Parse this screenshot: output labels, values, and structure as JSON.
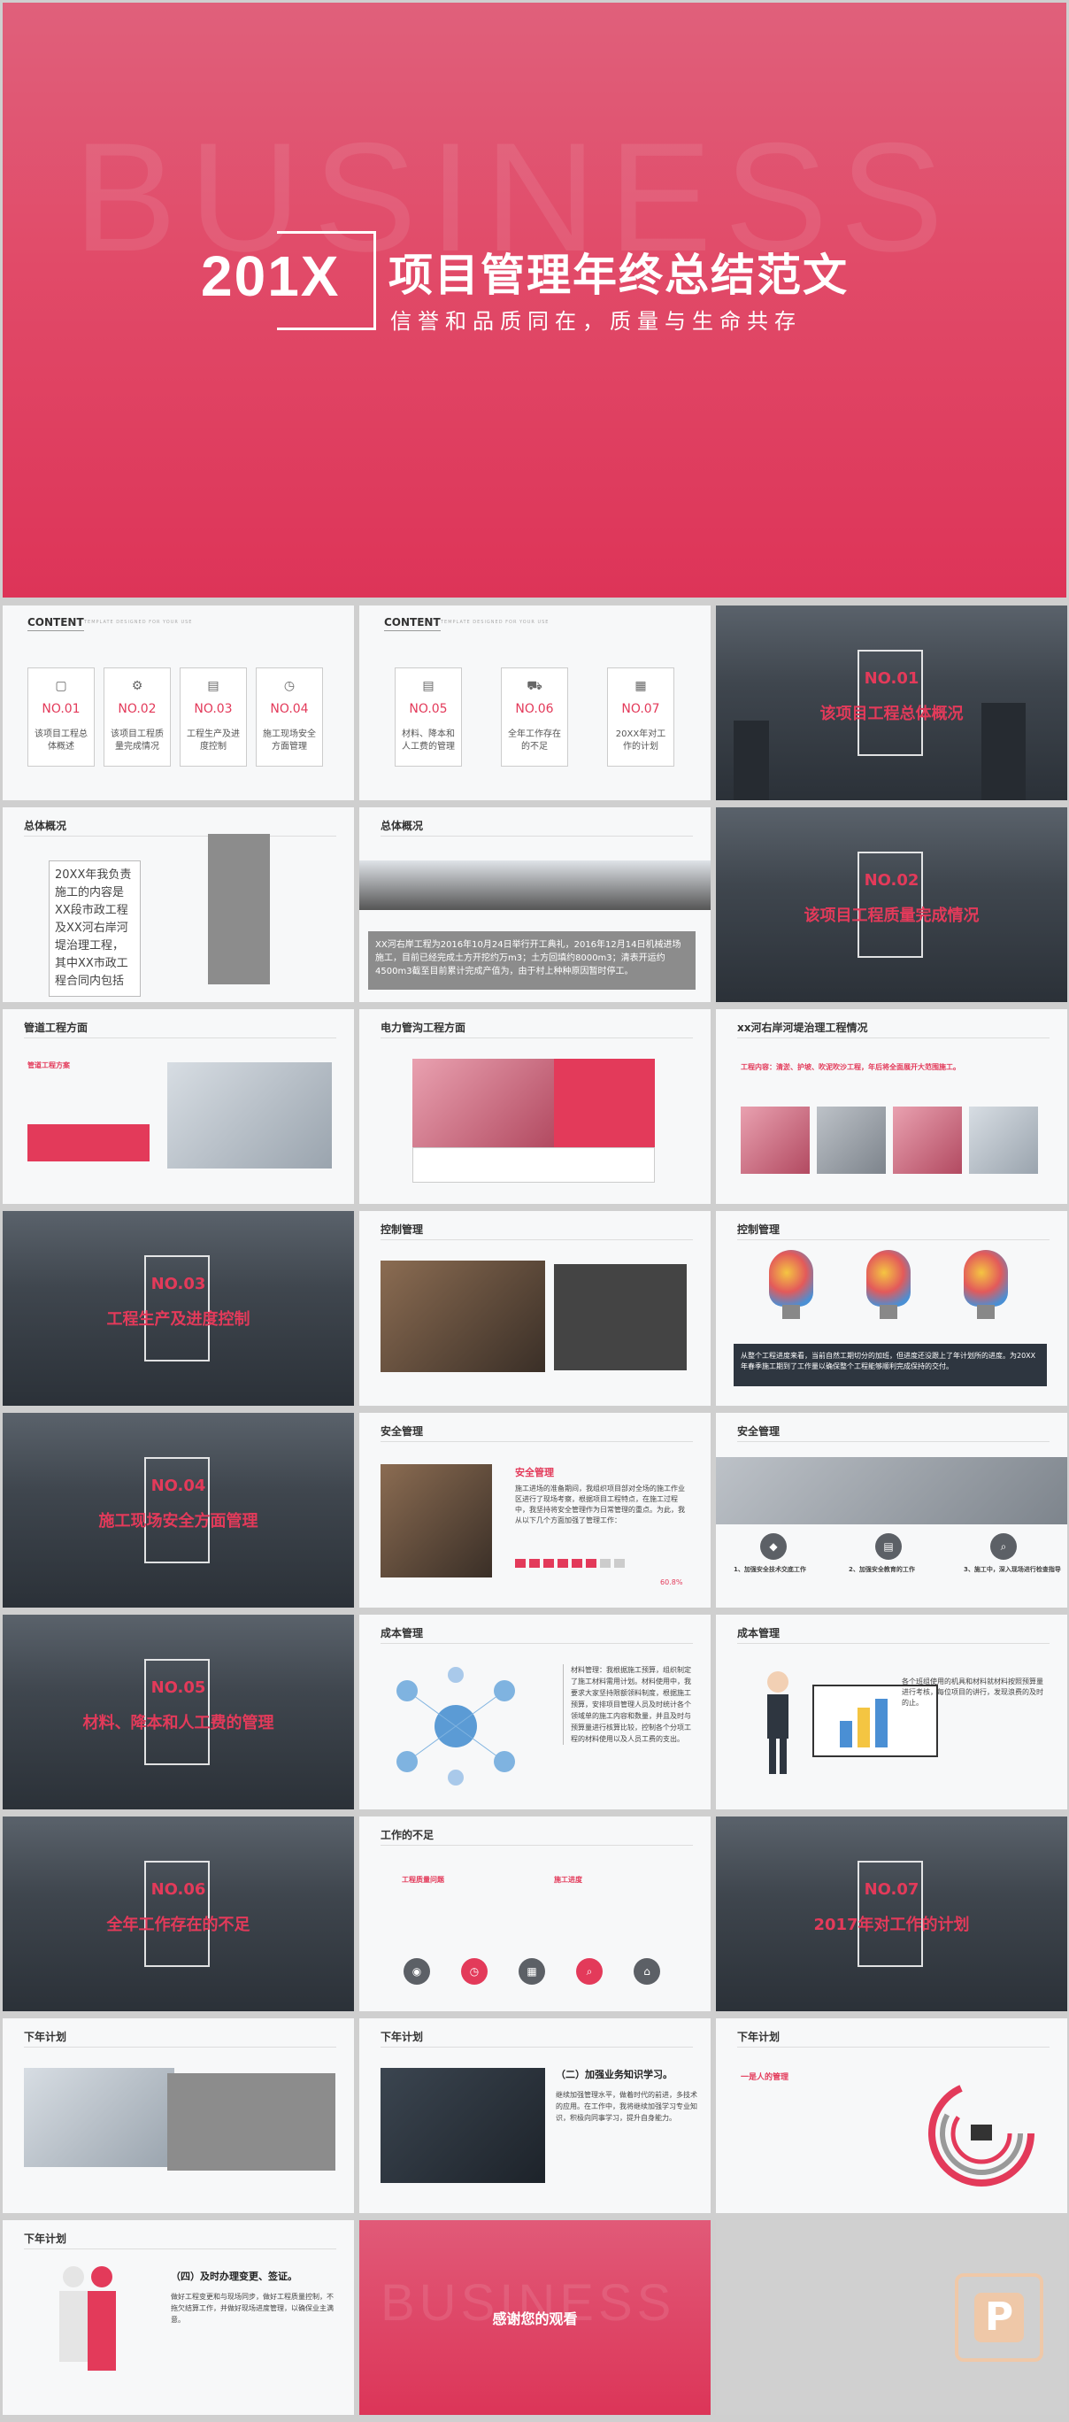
{
  "hero": {
    "watermark": "BUSINESS",
    "year": "201X",
    "title": "项目管理年终总结范文",
    "subtitle": "信誉和品质同在，质量与生命共存"
  },
  "content": {
    "heading": "CONTENT",
    "sub": "TEMPLATE DESIGNED FOR YOUR USE",
    "items_a": [
      {
        "no": "NO.01",
        "text": "该项目工程总体概述"
      },
      {
        "no": "NO.02",
        "text": "该项目工程质量完成情况"
      },
      {
        "no": "NO.03",
        "text": "工程生产及进度控制"
      },
      {
        "no": "NO.04",
        "text": "施工现场安全方面管理"
      }
    ],
    "items_b": [
      {
        "no": "NO.05",
        "text": "材料、降本和人工费的管理"
      },
      {
        "no": "NO.06",
        "text": "全年工作存在的不足"
      },
      {
        "no": "NO.07",
        "text": "20XX年对工作的计划"
      }
    ]
  },
  "sections": [
    {
      "no": "NO.01",
      "title": "该项目工程总体概况"
    },
    {
      "no": "NO.02",
      "title": "该项目工程质量完成情况"
    },
    {
      "no": "NO.03",
      "title": "工程生产及进度控制"
    },
    {
      "no": "NO.04",
      "title": "施工现场安全方面管理"
    },
    {
      "no": "NO.05",
      "title": "材料、降本和人工费的管理"
    },
    {
      "no": "NO.06",
      "title": "全年工作存在的不足"
    },
    {
      "no": "NO.07",
      "title": "2017年对工作的计划"
    }
  ],
  "slides": {
    "overview1": {
      "heading": "总体概况",
      "text": "20XX年我负责施工的内容是XX段市政工程及XX河右岸河堤治理工程，其中XX市政工程合同内包括"
    },
    "overview2": {
      "heading": "总体概况",
      "text": "XX河右岸工程为2016年10月24日举行开工典礼，2016年12月14日机械进场施工，目前已经完成土方开挖约万m3；土方回填约8000m3；清表开运约4500m3截至目前累计完成产值为，由于村上种种原因暂时停工。"
    },
    "pipe": {
      "heading": "管道工程方面",
      "label": "管道工程方案"
    },
    "power": {
      "heading": "电力管沟工程方面"
    },
    "river": {
      "heading": "xx河右岸河堤治理工程情况",
      "label": "工程内容：清淤、护坡、吹泥吹沙工程，年后将全面展开大范围施工。"
    },
    "control1": {
      "heading": "控制管理"
    },
    "control2": {
      "heading": "控制管理",
      "text": "从整个工程进度来看，当前自然工期切分的加班，但进度还没跟上了年计划所的进度。为20XX年春季施工期到了工作量以确保整个工程能够顺利完成保持的交付。"
    },
    "safety1": {
      "heading": "安全管理",
      "label": "安全管理",
      "text": "施工进场的准备期间，我组织项目部对全场的施工作业区进行了现场考察，根据项目工程特点，在施工过程中，我坚持将安全管理作为日常管理的重点。为此，我从以下几个方面加强了管理工作：",
      "percent": "60.8%"
    },
    "safety2": {
      "heading": "安全管理",
      "items": [
        "1、加强安全技术交底工作",
        "2、加强安全教育的工作",
        "3、施工中，深入现场进行检查指导"
      ]
    },
    "cost1": {
      "heading": "成本管理",
      "text": "材料管理：我根据施工预算，组织制定了施工材料需用计划。材料使用中，我要求大家坚持限额领料制度，根据施工预算，安排项目管理人员及时统计各个领域单的施工内容和数量，并且及时与预算量进行核算比较，控制各个分项工程的材料使用以及人员工费的支出。"
    },
    "cost2": {
      "heading": "成本管理",
      "text": "各个班组使用的机具和材料就材料按照预算量进行考核，每位项目的讲行，发现浪费的及时的止。"
    },
    "shortfall": {
      "heading": "工作的不足",
      "left": "工程质量问题",
      "right": "施工进度"
    },
    "plan1": {
      "heading": "下年计划"
    },
    "plan2": {
      "heading": "下年计划",
      "label": "（二）加强业务知识学习。",
      "text": "继续加强管理水平，做着时代的前进，多技术的应用。在工作中，我将继续加强学习专业知识，积极向同事学习，提升自身能力。"
    },
    "plan3": {
      "heading": "下年计划",
      "label": "一是人的管理"
    },
    "plan4": {
      "heading": "下年计划",
      "label": "（四）及时办理变更、签证。",
      "text": "做好工程变更和与现场同步，做好工程质量控制，不拖欠结算工作，并做好现场进度管理，以确保业主满意。"
    },
    "closing": {
      "watermark": "BUSINESS",
      "text": "感谢您的观看"
    }
  },
  "colors": {
    "accent": "#e33a5a",
    "dark": "#3e4650"
  }
}
